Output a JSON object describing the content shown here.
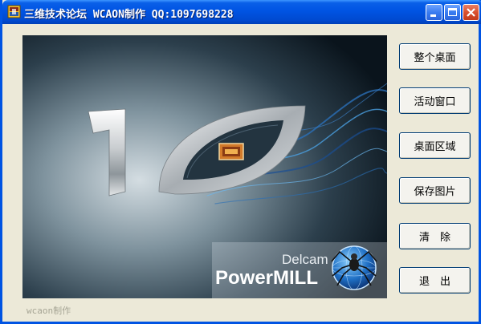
{
  "window": {
    "title": "三维技术论坛 WCAON制作 QQ:1097698228"
  },
  "splash": {
    "brand_top": "Delcam",
    "brand_main": "PowerMILL",
    "version_mark": "10"
  },
  "buttons": {
    "full_desktop": "整个桌面",
    "active_window": "活动窗口",
    "desktop_region": "桌面区域",
    "save_image": "保存图片",
    "clear": "清　除",
    "exit": "退　出"
  },
  "footer": {
    "credit": "wcaon制作"
  },
  "colors": {
    "titlebar": "#0054e3",
    "window_bg": "#ece9d8",
    "close_button": "#d9502f"
  }
}
